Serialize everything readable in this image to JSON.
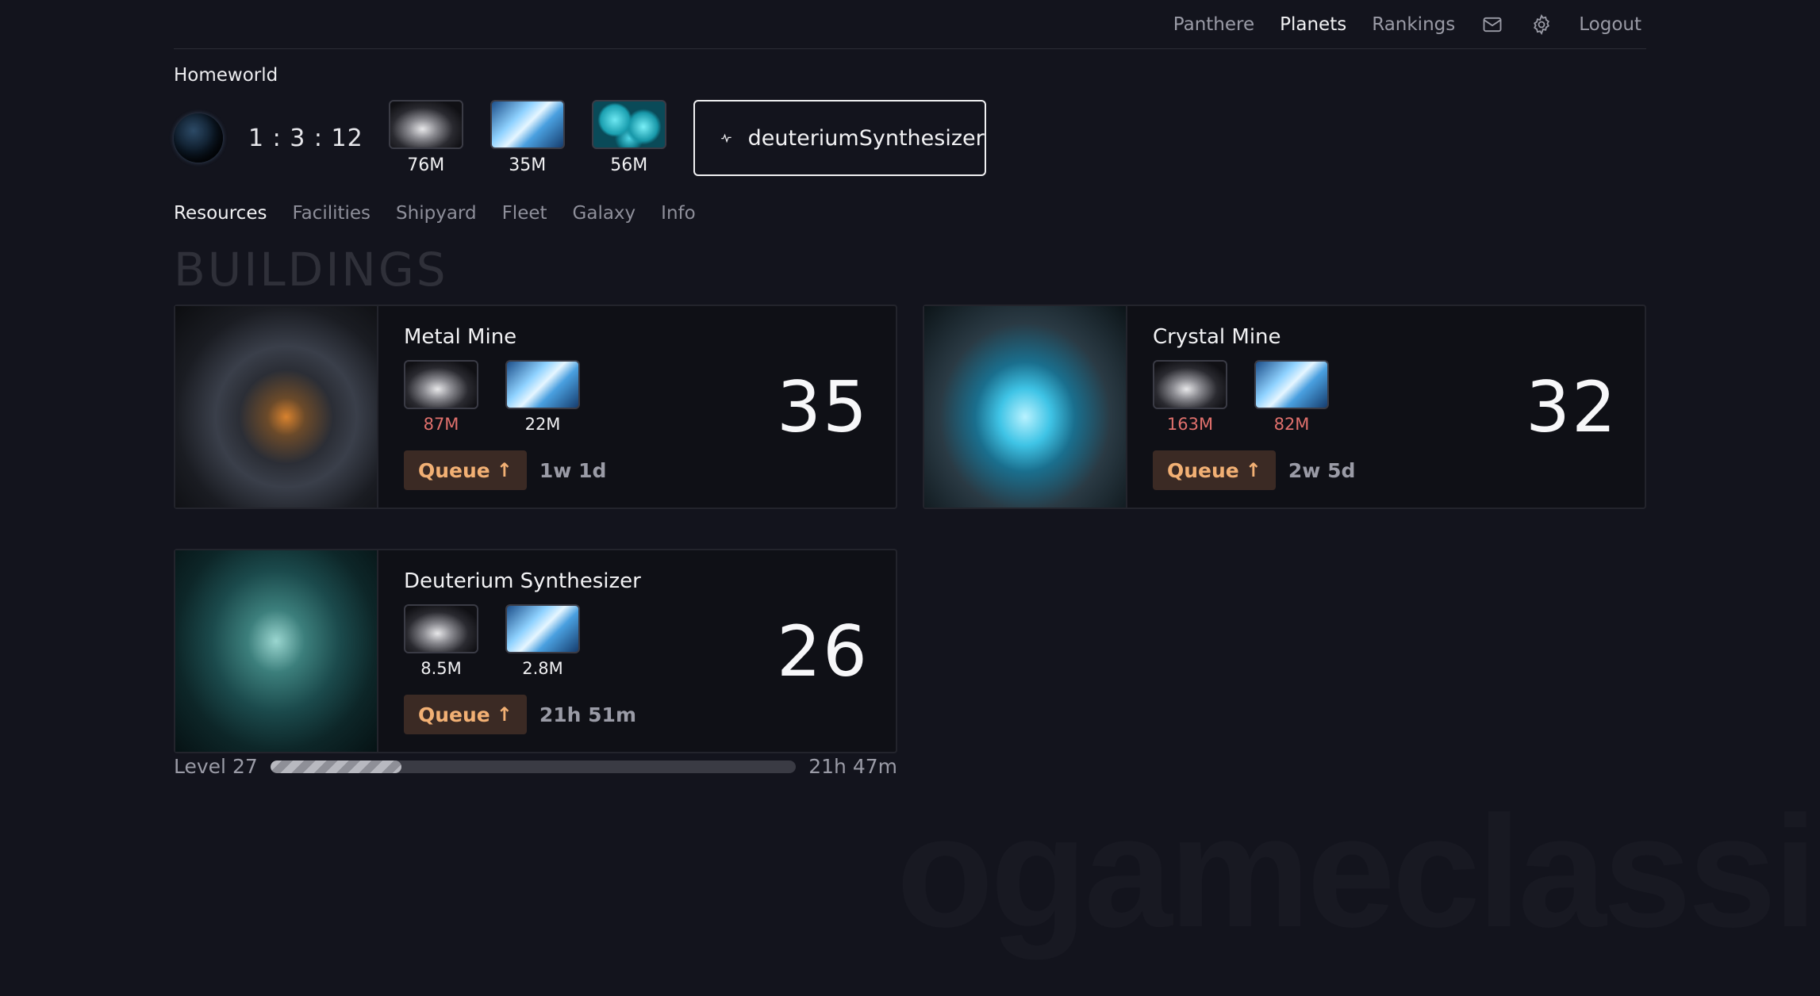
{
  "watermark": "ogameclassic",
  "nav": {
    "player": "Panthere",
    "planets": "Planets",
    "rankings": "Rankings",
    "logout": "Logout"
  },
  "planet": {
    "name": "Homeworld",
    "coords": "1 : 3 : 12",
    "resources": [
      {
        "name": "metal",
        "amount": "76M"
      },
      {
        "name": "crystal",
        "amount": "35M"
      },
      {
        "name": "deuterium",
        "amount": "56M"
      }
    ],
    "selector": "deuteriumSynthesizer"
  },
  "tabs": [
    "Resources",
    "Facilities",
    "Shipyard",
    "Fleet",
    "Galaxy",
    "Info"
  ],
  "section_title": "BUILDINGS",
  "buildings": [
    {
      "name": "Metal Mine",
      "level": "35",
      "cost_metal": "87M",
      "cost_crystal": "22M",
      "queue_label": "Queue",
      "duration": "1w 1d"
    },
    {
      "name": "Crystal Mine",
      "level": "32",
      "cost_metal": "163M",
      "cost_crystal": "82M",
      "queue_label": "Queue",
      "duration": "2w 5d"
    },
    {
      "name": "Deuterium Synthesizer",
      "level": "26",
      "cost_metal": "8.5M",
      "cost_crystal": "2.8M",
      "queue_label": "Queue",
      "duration": "21h 51m"
    }
  ],
  "progress": {
    "label": "Level 27",
    "remaining": "21h 47m",
    "fraction": 0.25
  },
  "colors": {
    "background": "#13141d",
    "queue_bg": "#3b2a24",
    "queue_text": "#f2b074",
    "insufficient": "#e0706c"
  }
}
